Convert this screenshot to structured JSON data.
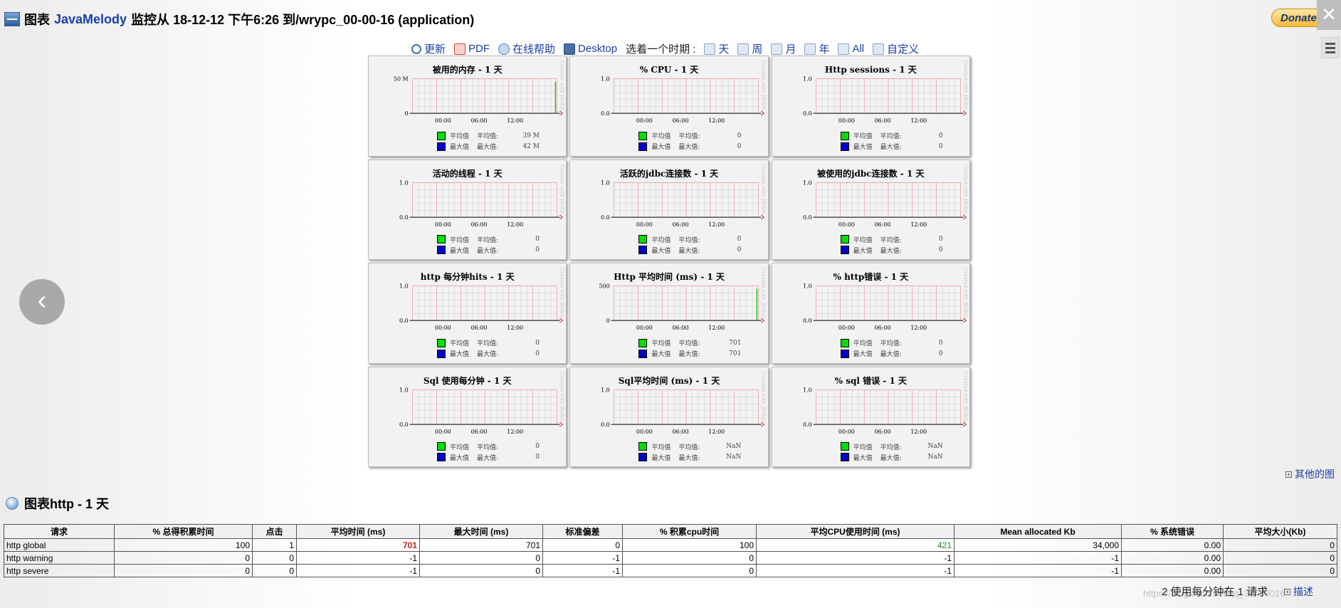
{
  "header": {
    "title_prefix": "图表",
    "brand": "JavaMelody",
    "title_suffix": "监控从 18-12-12 下午6:26 到/wrypc_00-00-16 (application)",
    "donate_label": "Donate"
  },
  "toolbar": {
    "items": [
      {
        "label": "更新",
        "icon": "refresh-icon",
        "color": "#3b6fc4"
      },
      {
        "label": "PDF",
        "icon": "pdf-icon",
        "color": "#d8442d"
      },
      {
        "label": "在线帮助",
        "icon": "help-icon",
        "color": "#4a7fc9"
      },
      {
        "label": "Desktop",
        "icon": "desktop-icon",
        "color": "#4a6fa8"
      }
    ],
    "period_label": "选着一个时期 :",
    "periods": [
      {
        "label": "天",
        "icon": "calendar-icon"
      },
      {
        "label": "周",
        "icon": "calendar-icon"
      },
      {
        "label": "月",
        "icon": "calendar-icon"
      },
      {
        "label": "年",
        "icon": "calendar-icon"
      },
      {
        "label": "All",
        "icon": "calendar-icon"
      },
      {
        "label": "自定义",
        "icon": "calendar-icon"
      }
    ]
  },
  "charts": [
    {
      "title": "被用的内存 - 1 天",
      "y_top": "50 M",
      "y_bottom": "0",
      "avg_label": "平均值",
      "avg_value": "39 M",
      "max_label": "最大值",
      "max_value": "42 M",
      "spike": true,
      "spike_color": "#00cc00"
    },
    {
      "title": "% CPU - 1 天",
      "y_top": "1.0",
      "y_bottom": "0.0",
      "avg_label": "平均值",
      "avg_value": "0",
      "max_label": "最大值",
      "max_value": "0",
      "spike": false
    },
    {
      "title": "Http sessions - 1 天",
      "y_top": "1.0",
      "y_bottom": "0.0",
      "avg_label": "平均值",
      "avg_value": "0",
      "max_label": "最大值",
      "max_value": "0",
      "spike": false
    },
    {
      "title": "活动的线程 - 1 天",
      "y_top": "1.0",
      "y_bottom": "0.0",
      "avg_label": "平均值",
      "avg_value": "0",
      "max_label": "最大值",
      "max_value": "0",
      "spike": false
    },
    {
      "title": "活跃的jdbc连接数 - 1 天",
      "y_top": "1.0",
      "y_bottom": "0.0",
      "avg_label": "平均值",
      "avg_value": "0",
      "max_label": "最大值",
      "max_value": "0",
      "spike": false
    },
    {
      "title": "被使用的jdbc连接数 - 1 天",
      "y_top": "1.0",
      "y_bottom": "0.0",
      "avg_label": "平均值",
      "avg_value": "0",
      "max_label": "最大值",
      "max_value": "0",
      "spike": false
    },
    {
      "title": "http 每分钟hits - 1 天",
      "y_top": "1.0",
      "y_bottom": "0.0",
      "avg_label": "平均值",
      "avg_value": "0",
      "max_label": "最大值",
      "max_value": "0",
      "spike": false
    },
    {
      "title": "Http 平均时间 (ms) - 1 天",
      "y_top": "500",
      "y_bottom": "0",
      "avg_label": "平均值",
      "avg_value": "701",
      "max_label": "最大值",
      "max_value": "701",
      "spike": true,
      "spike_color": "#00cc00"
    },
    {
      "title": "% http错误 - 1 天",
      "y_top": "1.0",
      "y_bottom": "0.0",
      "avg_label": "平均值",
      "avg_value": "0",
      "max_label": "最大值",
      "max_value": "0",
      "spike": false
    },
    {
      "title": "Sql 使用每分钟 - 1 天",
      "y_top": "1.0",
      "y_bottom": "0.0",
      "avg_label": "平均值",
      "avg_value": "0",
      "max_label": "最大值",
      "max_value": "0",
      "spike": false
    },
    {
      "title": "Sql平均时间 (ms) - 1 天",
      "y_top": "1.0",
      "y_bottom": "0.0",
      "avg_label": "平均值",
      "avg_value": "NaN",
      "max_label": "最大值",
      "max_value": "NaN",
      "spike": false
    },
    {
      "title": "% sql 错误 - 1 天",
      "y_top": "1.0",
      "y_bottom": "0.0",
      "avg_label": "平均值",
      "avg_value": "NaN",
      "max_label": "最大值",
      "max_value": "NaN",
      "spike": false
    }
  ],
  "chart_common": {
    "x_ticks": [
      "00:00",
      "06:00",
      "12:00"
    ],
    "legend_avg_short": "平均值",
    "legend_max_short": "最大值",
    "avg_color": "#00dd00",
    "max_color": "#0000cc",
    "watermark_text": "Created with JRobin"
  },
  "other_graphs_label": "其他的图",
  "section": {
    "title": "图表http - 1 天"
  },
  "table": {
    "headers": [
      "请求",
      "% 总得积累时间",
      "点击",
      "平均时间 (ms)",
      "最大时间 (ms)",
      "标准偏差",
      "% 积累cpu时间",
      "平均CPU使用时间 (ms)",
      "Mean allocated Kb",
      "% 系统错误",
      "平均大小(Kb)"
    ],
    "rows": [
      [
        "http global",
        "100",
        "1",
        "701",
        "701",
        "0",
        "100",
        "421",
        "34,000",
        "0.00",
        "0"
      ],
      [
        "http warning",
        "0",
        "0",
        "-1",
        "0",
        "-1",
        "0",
        "-1",
        "-1",
        "0.00",
        "0"
      ],
      [
        "http severe",
        "0",
        "0",
        "-1",
        "0",
        "-1",
        "0",
        "-1",
        "-1",
        "0.00",
        "0"
      ]
    ]
  },
  "footer": {
    "usage_note": "2 使用每分钟在 1 请求",
    "description_link": "描述",
    "watermark": "https://blog.csdn.net/qq_33430016"
  }
}
